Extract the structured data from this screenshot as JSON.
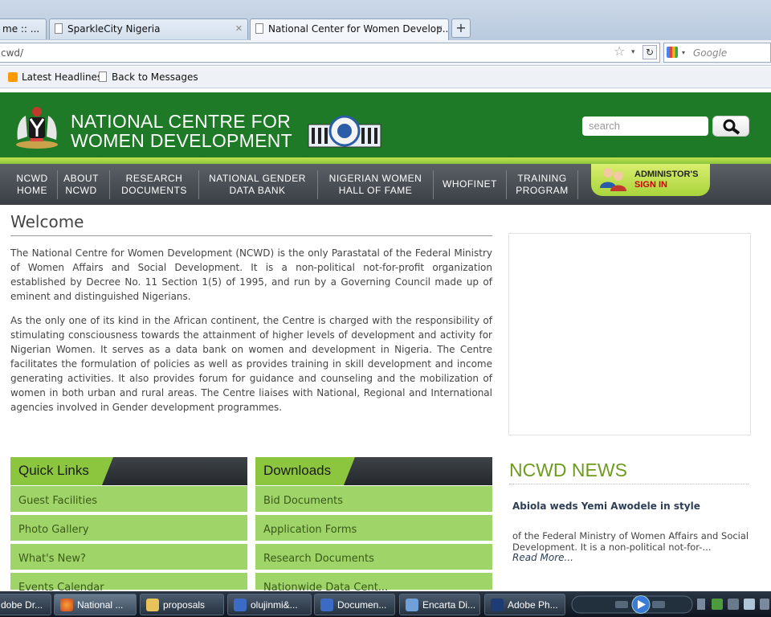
{
  "browser": {
    "tabs": [
      {
        "title": "me :: ..."
      },
      {
        "title": "SparkleCity Nigeria"
      },
      {
        "title": "National Center for Women Develop..."
      }
    ],
    "url": "cwd/",
    "search_engine_placeholder": "Google",
    "bookmarks": [
      "Latest Headlines",
      "Back to Messages"
    ]
  },
  "site": {
    "name_line1": "NATIONAL CENTRE FOR",
    "name_line2": "WOMEN DEVELOPMENT",
    "search_placeholder": "search",
    "nav": [
      {
        "line1": "NCWD",
        "line2": "HOME"
      },
      {
        "line1": "ABOUT",
        "line2": "NCWD"
      },
      {
        "line1": "RESEARCH",
        "line2": "DOCUMENTS"
      },
      {
        "line1": "NATIONAL GENDER",
        "line2": "DATA BANK"
      },
      {
        "line1": "NIGERIAN WOMEN",
        "line2": "HALL OF FAME"
      },
      {
        "line1": "WHOFINET",
        "line2": ""
      },
      {
        "line1": "TRAINING",
        "line2": "PROGRAM"
      }
    ],
    "admin": {
      "line1": "ADMINISTOR'S",
      "line2": "SIGN IN"
    }
  },
  "content": {
    "welcome_title": "Welcome",
    "para1": "The National Centre for Women Development (NCWD) is the only Parastatal of the Federal Ministry of Women Affairs and Social Development. It is a non-political not-for-profit organization established by Decree No. 11 Section 1(5) of 1995, and run by a Governing Council made up of eminent and distinguished Nigerians.",
    "para2": "As the only one of its kind in the African continent, the Centre is charged with the responsibility of stimulating consciousness towards the attainment of higher levels of development and activity for Nigerian Women. It serves as a data bank on women and development in Nigeria. The Centre facilitates the formulation of policies as well as provides training in skill development and income generating activities. It also provides forum for guidance and counseling and the mobilization of women in both urban and rural areas. The Centre liaises with National, Regional and International agencies involved in Gender development programmes."
  },
  "quick_links": {
    "title": "Quick Links",
    "items": [
      "Guest Facilities",
      "Photo Gallery",
      "What's New?",
      "Events Calendar"
    ]
  },
  "downloads": {
    "title": "Downloads",
    "items": [
      "Bid Documents",
      "Application Forms",
      "Research Documents",
      "Nationwide Data Cent..."
    ]
  },
  "news": {
    "title": "NCWD NEWS",
    "headline": "Abiola weds Yemi Awodele in style",
    "body": "of the Federal Ministry of Women Affairs and Social Development. It is a non-political not-for-...",
    "read_more": "Read More..."
  },
  "taskbar": {
    "items": [
      "dobe Dr...",
      "National ...",
      "proposals",
      "olujinmi&...",
      "Documen...",
      "Encarta Di...",
      "Adobe Ph..."
    ]
  },
  "colors": {
    "header_green": "#1e7a26",
    "accent_green": "#8cc63f",
    "link_bg": "#9ed468",
    "news_title": "#6e9b1f"
  }
}
